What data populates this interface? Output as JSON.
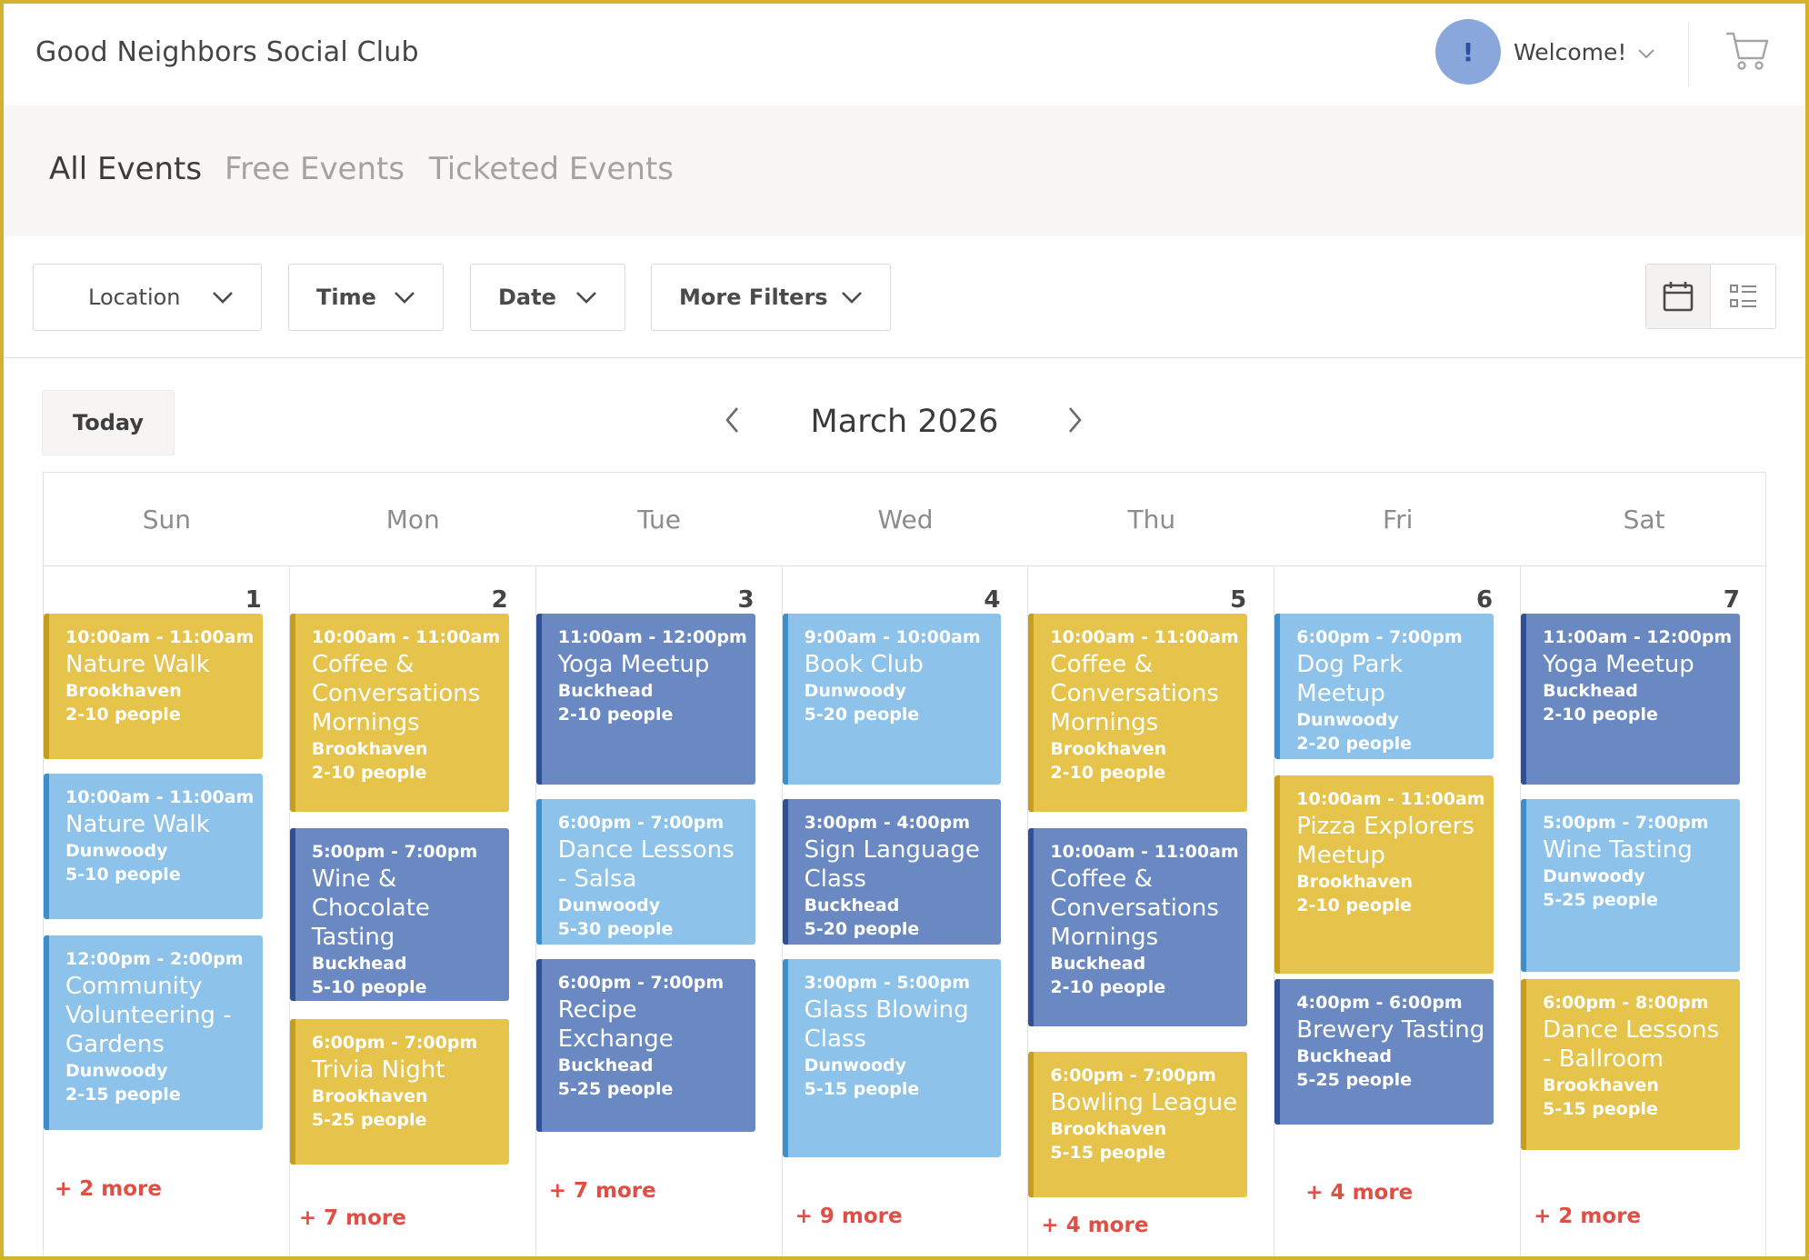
{
  "header": {
    "brand": "Good Neighbors Social Club",
    "avatar_initial": "!",
    "welcome": "Welcome!",
    "cart_icon": "shopping-cart-icon"
  },
  "tabs": [
    {
      "label": "All Events",
      "active": true
    },
    {
      "label": "Free Events",
      "active": false
    },
    {
      "label": "Ticketed Events",
      "active": false
    }
  ],
  "filters": {
    "location": "Location",
    "time": "Time",
    "date": "Date",
    "more": "More Filters"
  },
  "view_toggle": {
    "calendar_icon": "calendar-icon",
    "list_icon": "list-icon",
    "active": "calendar"
  },
  "calendar": {
    "today_label": "Today",
    "month_label": "March 2026",
    "weekdays": [
      "Sun",
      "Mon",
      "Tue",
      "Wed",
      "Thu",
      "Fri",
      "Sat"
    ],
    "days": [
      {
        "date": "1",
        "more": "+ 2 more",
        "events": [
          {
            "time": "10:00am - 11:00am",
            "name": "Nature Walk",
            "location": "Brookhaven",
            "people": "2-10 people",
            "color": "yellow"
          },
          {
            "time": "10:00am - 11:00am",
            "name": "Nature Walk",
            "location": "Dunwoody",
            "people": "5-10 people",
            "color": "light"
          },
          {
            "time": "12:00pm - 2:00pm",
            "name": "Community Volunteering - Gardens",
            "location": "Dunwoody",
            "people": "2-15 people",
            "color": "light"
          }
        ]
      },
      {
        "date": "2",
        "more": "+ 7 more",
        "events": [
          {
            "time": "10:00am - 11:00am",
            "name": "Coffee & Conversations Mornings",
            "location": "Brookhaven",
            "people": "2-10 people",
            "color": "yellow"
          },
          {
            "time": "5:00pm - 7:00pm",
            "name": "Wine & Chocolate Tasting",
            "location": "Buckhead",
            "people": "5-10 people",
            "color": "dark"
          },
          {
            "time": "6:00pm - 7:00pm",
            "name": "Trivia Night",
            "location": "Brookhaven",
            "people": "5-25 people",
            "color": "yellow"
          }
        ]
      },
      {
        "date": "3",
        "more": "+ 7 more",
        "events": [
          {
            "time": "11:00am - 12:00pm",
            "name": "Yoga Meetup",
            "location": "Buckhead",
            "people": "2-10 people",
            "color": "dark"
          },
          {
            "time": "6:00pm - 7:00pm",
            "name": "Dance Lessons - Salsa",
            "location": "Dunwoody",
            "people": "5-30 people",
            "color": "light"
          },
          {
            "time": "6:00pm - 7:00pm",
            "name": "Recipe Exchange",
            "location": "Buckhead",
            "people": "5-25 people",
            "color": "dark"
          }
        ]
      },
      {
        "date": "4",
        "more": "+ 9 more",
        "events": [
          {
            "time": "9:00am - 10:00am",
            "name": "Book Club",
            "location": "Dunwoody",
            "people": "5-20 people",
            "color": "light"
          },
          {
            "time": "3:00pm - 4:00pm",
            "name": "Sign Language Class",
            "location": "Buckhead",
            "people": "5-20 people",
            "color": "dark"
          },
          {
            "time": "3:00pm - 5:00pm",
            "name": "Glass Blowing Class",
            "location": "Dunwoody",
            "people": "5-15 people",
            "color": "light"
          }
        ]
      },
      {
        "date": "5",
        "more": "+ 4 more",
        "events": [
          {
            "time": "10:00am - 11:00am",
            "name": "Coffee & Conversations Mornings",
            "location": "Brookhaven",
            "people": "2-10 people",
            "color": "yellow"
          },
          {
            "time": "10:00am - 11:00am",
            "name": "Coffee & Conversations Mornings",
            "location": "Buckhead",
            "people": "2-10 people",
            "color": "dark"
          },
          {
            "time": "6:00pm - 7:00pm",
            "name": "Bowling League",
            "location": "Brookhaven",
            "people": "5-15 people",
            "color": "yellow"
          }
        ]
      },
      {
        "date": "6",
        "more": "+ 4 more",
        "events": [
          {
            "time": "6:00pm - 7:00pm",
            "name": "Dog Park Meetup",
            "location": "Dunwoody",
            "people": "2-20 people",
            "color": "light"
          },
          {
            "time": "10:00am - 11:00am",
            "name": "Pizza Explorers Meetup",
            "location": "Brookhaven",
            "people": "2-10 people",
            "color": "yellow"
          },
          {
            "time": "4:00pm - 6:00pm",
            "name": "Brewery Tasting",
            "location": "Buckhead",
            "people": "5-25 people",
            "color": "dark"
          }
        ]
      },
      {
        "date": "7",
        "more": "+ 2 more",
        "events": [
          {
            "time": "11:00am - 12:00pm",
            "name": "Yoga Meetup",
            "location": "Buckhead",
            "people": "2-10 people",
            "color": "dark"
          },
          {
            "time": "5:00pm - 7:00pm",
            "name": "Wine Tasting",
            "location": "Dunwoody",
            "people": "5-25 people",
            "color": "light"
          },
          {
            "time": "6:00pm - 8:00pm",
            "name": "Dance Lessons - Ballroom",
            "location": "Brookhaven",
            "people": "5-15 people",
            "color": "yellow"
          }
        ]
      }
    ]
  },
  "colors": {
    "accent_border": "#d4b22e",
    "yellow": "#e6c34a",
    "light_blue": "#8dc3ea",
    "dark_blue": "#6a89c3",
    "more_link": "#e04f45"
  }
}
